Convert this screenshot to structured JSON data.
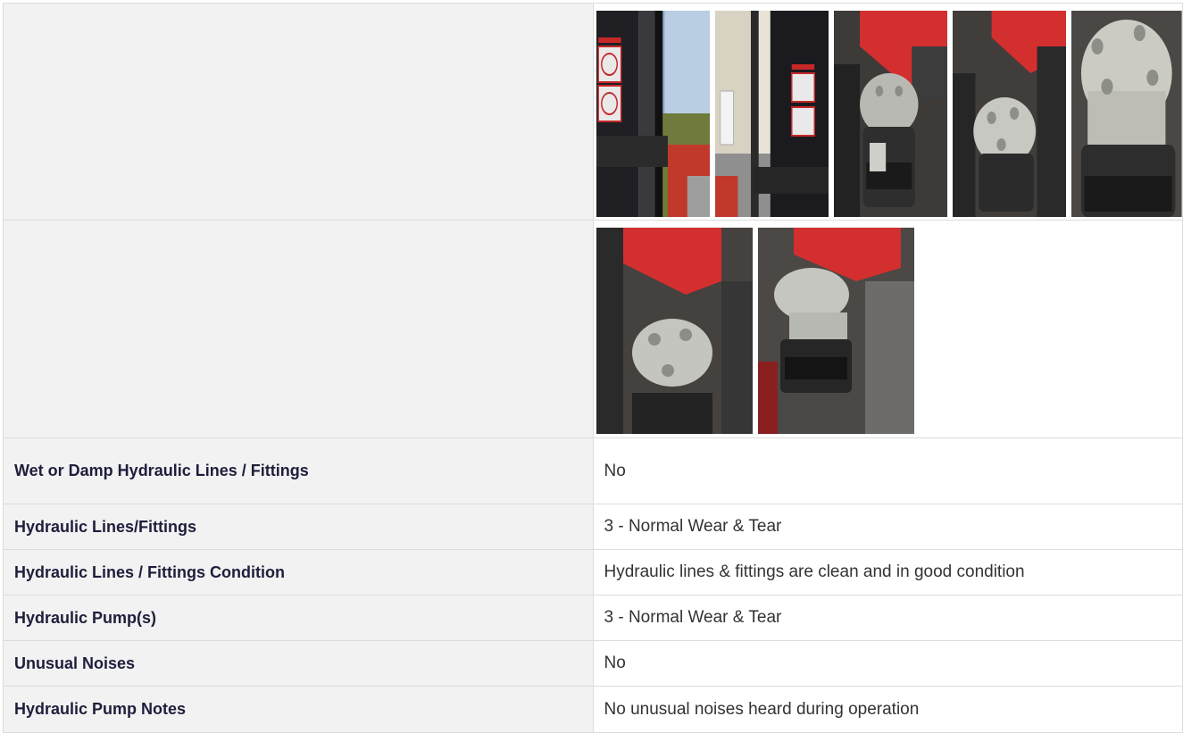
{
  "photos": {
    "row1": [
      {
        "subject": "mast-warning-decals"
      },
      {
        "subject": "mast-and-building"
      },
      {
        "subject": "hydraulic-pump-top"
      },
      {
        "subject": "hydraulic-pump-angle"
      },
      {
        "subject": "hydraulic-pump-closeup"
      }
    ],
    "row2": [
      {
        "subject": "hydraulic-pump-lines"
      },
      {
        "subject": "hydraulic-pump-motor"
      }
    ]
  },
  "rows": [
    {
      "label": "Wet or Damp Hydraulic Lines / Fittings",
      "value": "No"
    },
    {
      "label": "Hydraulic Lines/Fittings",
      "value": "3 - Normal Wear & Tear"
    },
    {
      "label": "Hydraulic Lines / Fittings Condition",
      "value": "Hydraulic lines & fittings are clean and in good condition"
    },
    {
      "label": "Hydraulic Pump(s)",
      "value": "3 - Normal Wear & Tear"
    },
    {
      "label": "Unusual Noises",
      "value": "No"
    },
    {
      "label": "Hydraulic Pump Notes",
      "value": "No unusual noises heard during operation"
    }
  ]
}
